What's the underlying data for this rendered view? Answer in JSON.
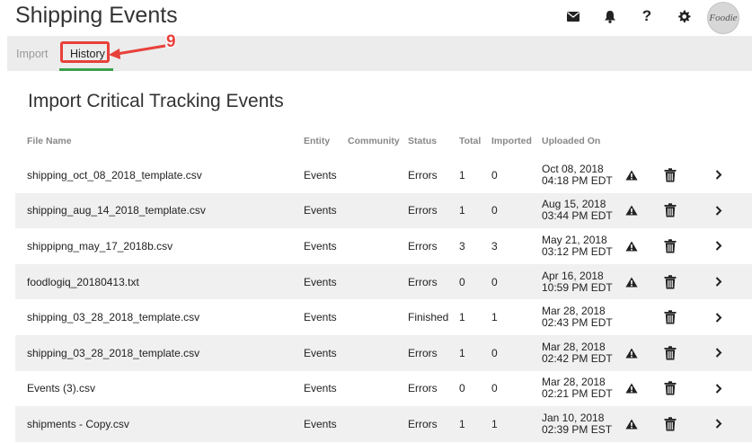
{
  "header": {
    "title": "Shipping Events",
    "avatar_text": "Foodie",
    "icons": [
      "envelope-icon",
      "bell-icon",
      "question-icon",
      "gear-icon"
    ]
  },
  "tabs": [
    {
      "label": "Import",
      "active": false
    },
    {
      "label": "History",
      "active": true
    }
  ],
  "callout": {
    "number": "9",
    "color": "#e8403a"
  },
  "accent_color": "#3aa14a",
  "section_title": "Import Critical Tracking Events",
  "table": {
    "columns": [
      "File Name",
      "Entity",
      "Community",
      "Status",
      "Total",
      "Imported",
      "Uploaded On"
    ],
    "rows": [
      {
        "file": "shipping_oct_08_2018_template.csv",
        "entity": "Events",
        "community": "",
        "status": "Errors",
        "total": "1",
        "imported": "0",
        "date": "Oct 08, 2018",
        "time": "04:18 PM EDT",
        "warning": true
      },
      {
        "file": "shipping_aug_14_2018_template.csv",
        "entity": "Events",
        "community": "",
        "status": "Errors",
        "total": "1",
        "imported": "0",
        "date": "Aug 15, 2018",
        "time": "03:44 PM EDT",
        "warning": true
      },
      {
        "file": "shippipng_may_17_2018b.csv",
        "entity": "Events",
        "community": "",
        "status": "Errors",
        "total": "3",
        "imported": "3",
        "date": "May 21, 2018",
        "time": "03:12 PM EDT",
        "warning": true
      },
      {
        "file": "foodlogiq_20180413.txt",
        "entity": "Events",
        "community": "",
        "status": "Errors",
        "total": "0",
        "imported": "0",
        "date": "Apr 16, 2018",
        "time": "10:59 PM EDT",
        "warning": true
      },
      {
        "file": "shipping_03_28_2018_template.csv",
        "entity": "Events",
        "community": "",
        "status": "Finished",
        "total": "1",
        "imported": "1",
        "date": "Mar 28, 2018",
        "time": "02:43 PM EDT",
        "warning": false
      },
      {
        "file": "shipping_03_28_2018_template.csv",
        "entity": "Events",
        "community": "",
        "status": "Errors",
        "total": "1",
        "imported": "0",
        "date": "Mar 28, 2018",
        "time": "02:42 PM EDT",
        "warning": true
      },
      {
        "file": "Events (3).csv",
        "entity": "Events",
        "community": "",
        "status": "Errors",
        "total": "0",
        "imported": "0",
        "date": "Mar 28, 2018",
        "time": "02:21 PM EDT",
        "warning": true
      },
      {
        "file": "shipments - Copy.csv",
        "entity": "Events",
        "community": "",
        "status": "Errors",
        "total": "1",
        "imported": "1",
        "date": "Jan 10, 2018",
        "time": "02:39 PM EST",
        "warning": true
      }
    ]
  }
}
